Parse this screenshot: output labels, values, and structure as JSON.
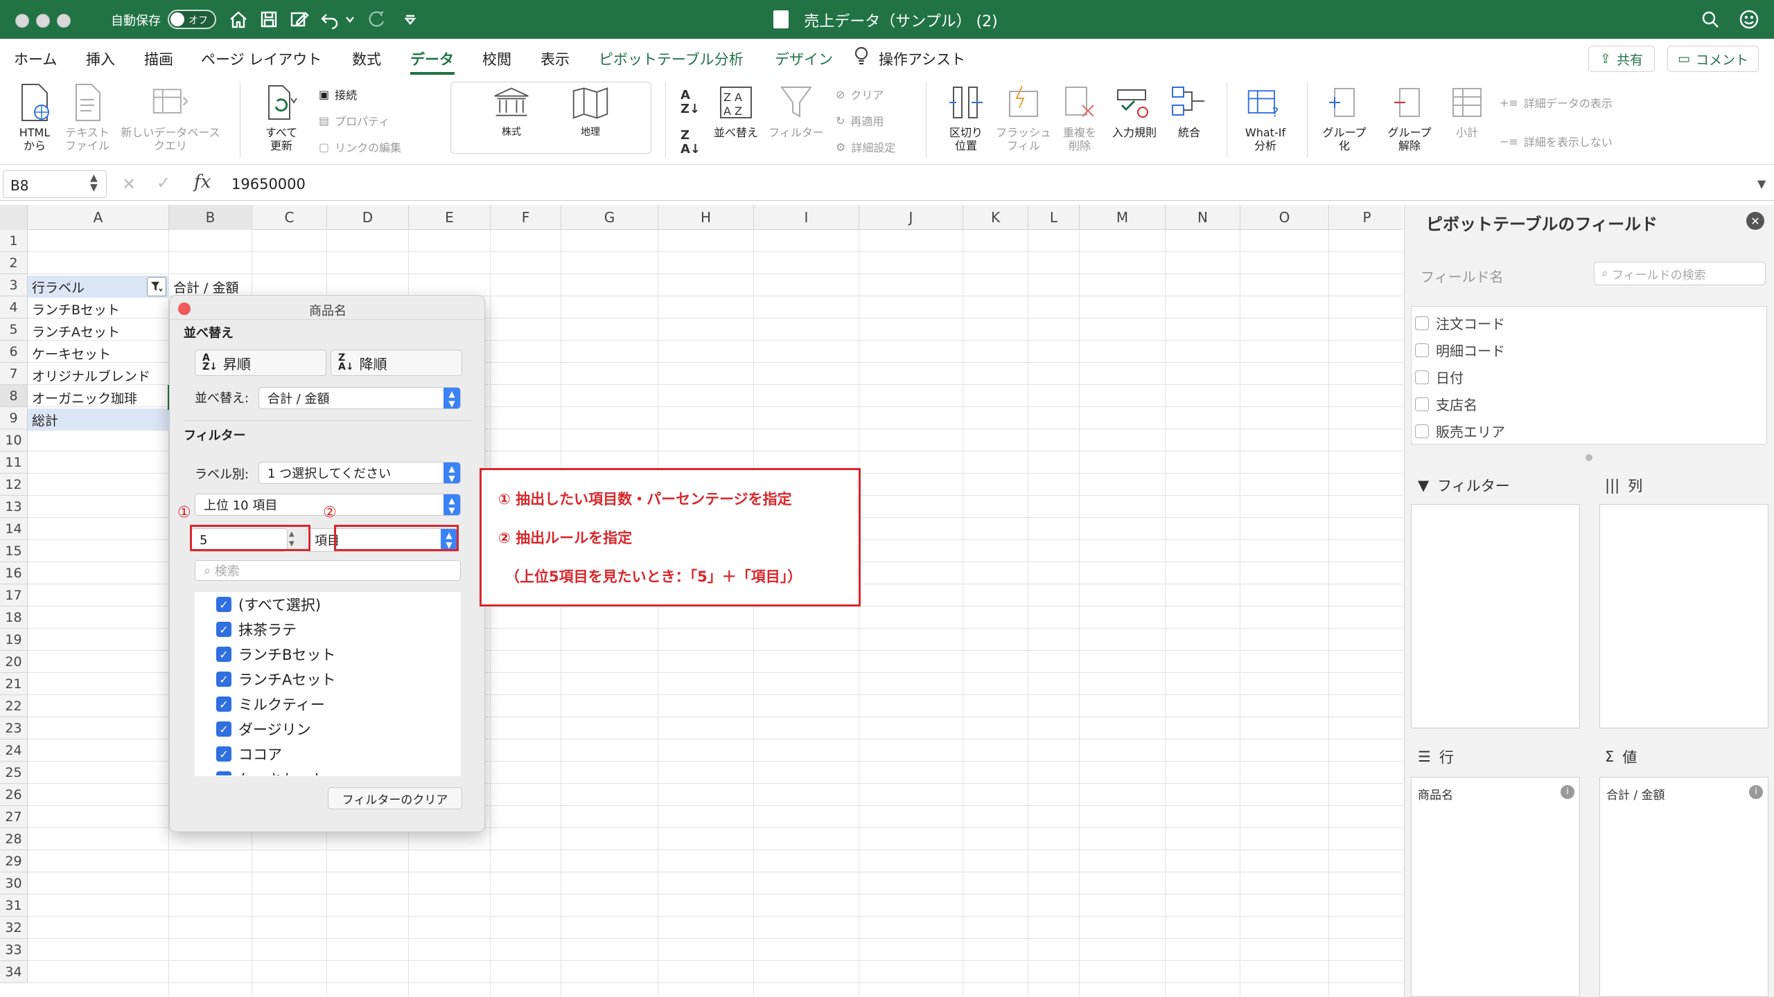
{
  "titlebar": {
    "autosave_label": "自動保存",
    "autosave_state": "オフ",
    "doc_title": "売上データ（サンプル） (2)",
    "icons": [
      "home-icon",
      "save-icon",
      "edit-icon",
      "undo-icon",
      "redo-icon",
      "customize-icon",
      "search-icon",
      "smiley-icon"
    ]
  },
  "menu": {
    "tabs": [
      "ホーム",
      "挿入",
      "描画",
      "ページ レイアウト",
      "数式",
      "データ",
      "校閲",
      "表示",
      "ピボットテーブル分析",
      "デザイン",
      "操作アシスト"
    ],
    "active_tab": "データ",
    "share": "共有",
    "comment": "コメント"
  },
  "ribbon": {
    "html": "HTML\nから",
    "text_file": "テキスト\nファイル",
    "new_db_query": "新しいデータベース\nクエリ",
    "refresh_all": "すべて\n更新",
    "connections": "接続",
    "properties": "プロパティ",
    "edit_links": "リンクの編集",
    "stocks": "株式",
    "geography": "地理",
    "sort": "並べ替え",
    "filter": "フィルター",
    "clear": "クリア",
    "reapply": "再適用",
    "advanced": "詳細設定",
    "text_to_columns": "区切り\n位置",
    "flash_fill": "フラッシュ\nフィル",
    "remove_duplicates": "重複を\n削除",
    "data_validation": "入力規則",
    "consolidate": "統合",
    "what_if": "What-If\n分析",
    "group": "グループ\n化",
    "ungroup": "グループ\n解除",
    "subtotal": "小計",
    "show_detail": "詳細データの表示",
    "hide_detail": "詳細を表示しない"
  },
  "formula": {
    "cell_ref": "B8",
    "value": "19650000"
  },
  "sheet": {
    "columns": [
      "A",
      "B",
      "C",
      "D",
      "E",
      "F",
      "G",
      "H",
      "I",
      "J",
      "K",
      "L",
      "M",
      "N",
      "O",
      "P"
    ],
    "rows": [
      "1",
      "2",
      "3",
      "4",
      "5",
      "6",
      "7",
      "8",
      "9",
      "10",
      "11",
      "12",
      "13",
      "14",
      "15",
      "16",
      "17",
      "18",
      "19",
      "20",
      "21",
      "22",
      "23",
      "24",
      "25",
      "26",
      "27",
      "28",
      "29",
      "30",
      "31",
      "32",
      "33",
      "34"
    ],
    "a3": "行ラベル",
    "b3": "合計 / 金額",
    "a_rows": [
      "ランチBセット",
      "ランチAセット",
      "ケーキセット",
      "オリジナルブレンド",
      "オーガニック珈琲",
      "総計"
    ]
  },
  "dialog": {
    "title": "商品名",
    "sort_heading": "並べ替え",
    "asc": "昇順",
    "desc": "降順",
    "sort_by_label": "並べ替え:",
    "sort_by_value": "合計 / 金額",
    "filter_heading": "フィルター",
    "by_label": "ラベル別:",
    "by_label_value": "1 つ選択してください",
    "top10": "上位 10 項目",
    "count_value": "5",
    "rule_value": "項目",
    "search_placeholder": "検索",
    "items": [
      "(すべて選択)",
      "抹茶ラテ",
      "ランチBセット",
      "ランチAセット",
      "ミルクティー",
      "ダージリン",
      "ココア",
      "ケーキセット"
    ],
    "clear_filter": "フィルターのクリア",
    "marker1": "①",
    "marker2": "②"
  },
  "callout": {
    "line1": "① 抽出したい項目数・パーセンテージを指定",
    "line2": "② 抽出ルールを指定",
    "line3": "（上位5項目を見たいとき：「5」＋「項目」）"
  },
  "pane": {
    "title": "ピボットテーブルのフィールド",
    "field_name": "フィールド名",
    "search_placeholder": "フィールドの検索",
    "fields": [
      "注文コード",
      "明細コード",
      "日付",
      "支店名",
      "販売エリア"
    ],
    "filters": "フィルター",
    "columns": "列",
    "rows": "行",
    "values": "値",
    "row_item": "商品名",
    "value_item": "合計 / 金額"
  },
  "colors": {
    "accent": "#217346",
    "annotation": "#d8272c",
    "checkbox": "#2f6fe0"
  }
}
